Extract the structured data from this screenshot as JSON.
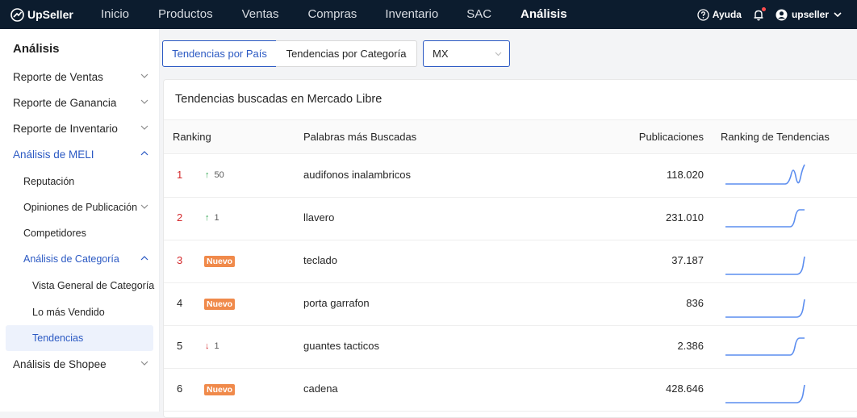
{
  "brand": {
    "name": "UpSeller"
  },
  "nav": [
    {
      "label": "Inicio"
    },
    {
      "label": "Productos"
    },
    {
      "label": "Ventas"
    },
    {
      "label": "Compras"
    },
    {
      "label": "Inventario"
    },
    {
      "label": "SAC"
    },
    {
      "label": "Análisis"
    }
  ],
  "top_right": {
    "help": "Ayuda",
    "user": "upseller"
  },
  "sidebar": {
    "title": "Análisis",
    "items": [
      {
        "label": "Reporte de Ventas"
      },
      {
        "label": "Reporte de Ganancia"
      },
      {
        "label": "Reporte de Inventario"
      },
      {
        "label": "Análisis de MELI"
      },
      {
        "label": "Reputación"
      },
      {
        "label": "Opiniones de Publicación"
      },
      {
        "label": "Competidores"
      },
      {
        "label": "Análisis de Categoría"
      },
      {
        "label": "Vista General de Categoría"
      },
      {
        "label": "Lo más Vendido"
      },
      {
        "label": "Tendencias"
      },
      {
        "label": "Análisis de Shopee"
      }
    ]
  },
  "tabs": [
    {
      "label": "Tendencias por País"
    },
    {
      "label": "Tendencias por Categoría"
    }
  ],
  "country_select": {
    "value": "MX"
  },
  "card": {
    "title": "Tendencias buscadas en Mercado Libre"
  },
  "table": {
    "headers": [
      "Ranking",
      "Palabras más Buscadas",
      "Publicaciones",
      "Ranking de Tendencias"
    ],
    "rows": [
      {
        "rank": "1",
        "change_dir": "up",
        "change": "50",
        "badge": "",
        "keyword": "audifonos inalambricos",
        "pubs": "118.020",
        "trend": "spike"
      },
      {
        "rank": "2",
        "change_dir": "up",
        "change": "1",
        "badge": "",
        "keyword": "llavero",
        "pubs": "231.010",
        "trend": "step"
      },
      {
        "rank": "3",
        "change_dir": "",
        "change": "",
        "badge": "Nuevo",
        "keyword": "teclado",
        "pubs": "37.187",
        "trend": "rise"
      },
      {
        "rank": "4",
        "change_dir": "",
        "change": "",
        "badge": "Nuevo",
        "keyword": "porta garrafon",
        "pubs": "836",
        "trend": "rise"
      },
      {
        "rank": "5",
        "change_dir": "down",
        "change": "1",
        "badge": "",
        "keyword": "guantes tacticos",
        "pubs": "2.386",
        "trend": "step"
      },
      {
        "rank": "6",
        "change_dir": "",
        "change": "",
        "badge": "Nuevo",
        "keyword": "cadena",
        "pubs": "428.646",
        "trend": "rise"
      }
    ]
  },
  "colors": {
    "topbar": "#0c1c2e",
    "accent": "#2b59c3",
    "rank_red": "#d4292c",
    "badge": "#f08a4b",
    "sparkline": "#5b8def"
  }
}
